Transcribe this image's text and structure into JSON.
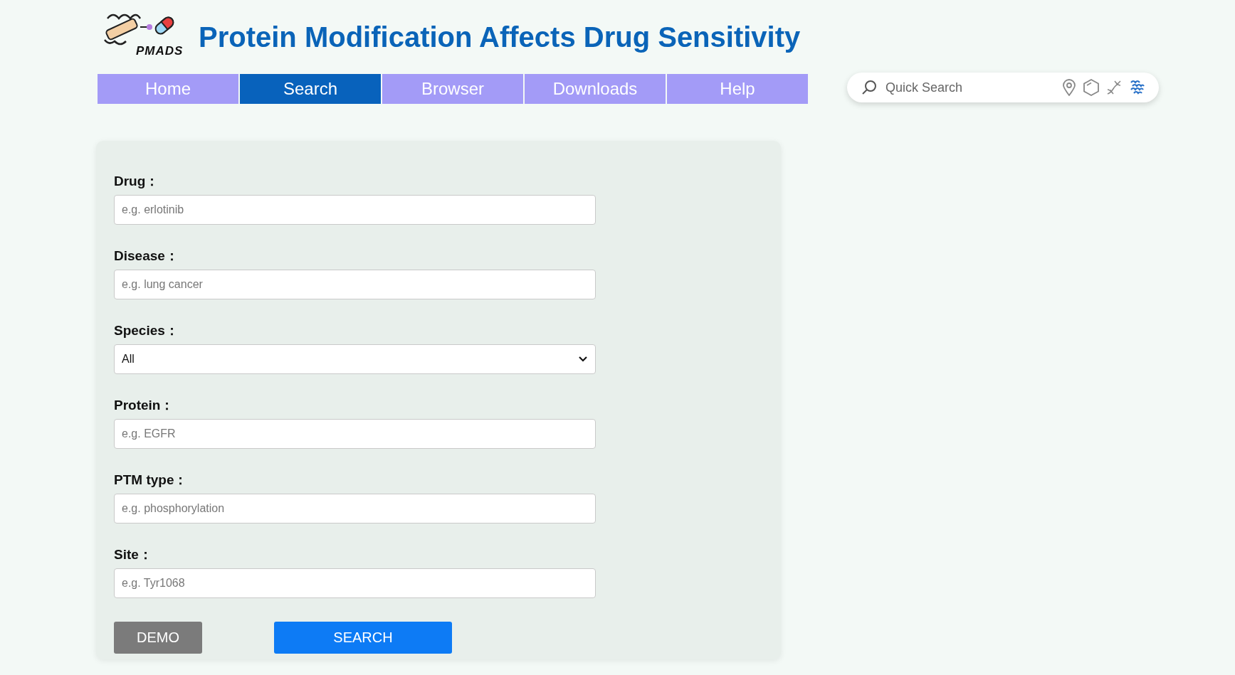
{
  "header": {
    "logo_text": "PMADS",
    "title": "Protein Modification Affects Drug Sensitivity"
  },
  "nav": [
    {
      "label": "Home",
      "selected": false
    },
    {
      "label": "Search",
      "selected": true
    },
    {
      "label": "Browser",
      "selected": false
    },
    {
      "label": "Downloads",
      "selected": false
    },
    {
      "label": "Help",
      "selected": false
    }
  ],
  "quick_search": {
    "placeholder": "Quick Search"
  },
  "form": {
    "fields": [
      {
        "kind": "text",
        "label": "Drug：",
        "placeholder": "e.g. erlotinib"
      },
      {
        "kind": "text",
        "label": "Disease：",
        "placeholder": "e.g. lung cancer"
      },
      {
        "kind": "select",
        "label": "Species：",
        "value": "All"
      },
      {
        "kind": "text",
        "label": "Protein：",
        "placeholder": "e.g. EGFR"
      },
      {
        "kind": "text",
        "label": "PTM type：",
        "placeholder": "e.g. phosphorylation"
      },
      {
        "kind": "text",
        "label": "Site：",
        "placeholder": "e.g. Tyr1068"
      }
    ],
    "buttons": [
      {
        "kind": "demo",
        "label": "DEMO"
      },
      {
        "kind": "search",
        "label": "SEARCH"
      }
    ]
  }
}
